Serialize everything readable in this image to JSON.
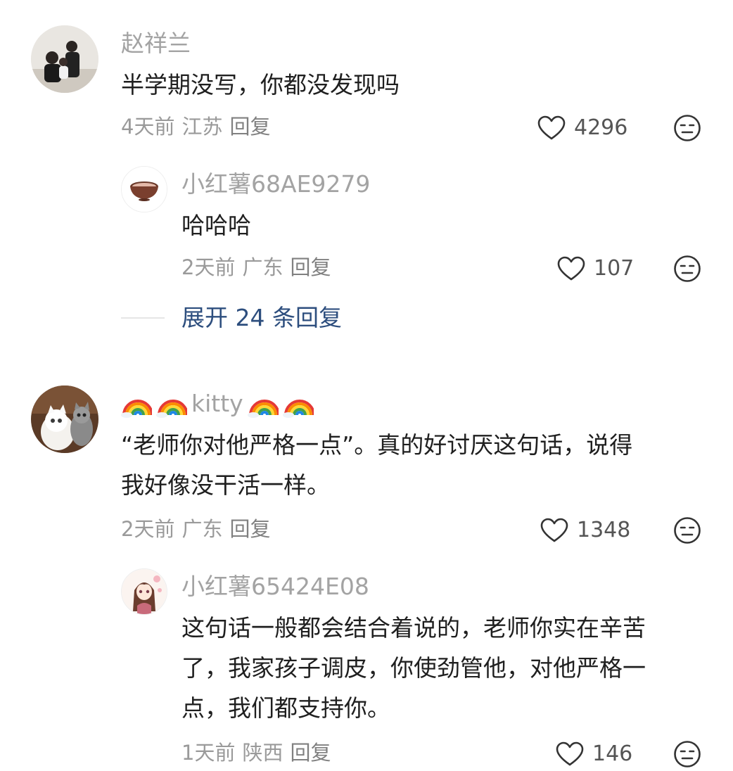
{
  "comments": [
    {
      "author": "赵祥兰",
      "text": "半学期没写，你都没发现吗",
      "time": "4天前",
      "location": "江苏",
      "reply_label": "回复",
      "likes": "4296",
      "replies": [
        {
          "author": "小红薯68AE9279",
          "text": "哈哈哈",
          "time": "2天前",
          "location": "广东",
          "reply_label": "回复",
          "likes": "107"
        }
      ],
      "expand_label": "展开 24 条回复"
    },
    {
      "author": "kitty",
      "author_emoji": "rainbow-emoji",
      "text_line1": "“老师你对他严格一点”。真的好讨厌这句话，说得",
      "text_line2": "我好像没干活一样。",
      "time": "2天前",
      "location": "广东",
      "reply_label": "回复",
      "likes": "1348",
      "replies": [
        {
          "author": "小红薯65424E08",
          "text_line1": "这句话一般都会结合着说的，老师你实在辛苦",
          "text_line2": "了，我家孩子调皮，你使劲管他，对他严格一",
          "text_line3": "点，我们都支持你。",
          "time": "1天前",
          "location": "陕西",
          "reply_label": "回复",
          "likes": "146"
        }
      ]
    }
  ],
  "icons": {
    "like": "heart-outline-icon",
    "dislike": "unamused-face-icon"
  },
  "colors": {
    "author": "#a3a3a3",
    "text": "#1f1f1f",
    "meta": "#9a9a9a",
    "expand": "#2d4e7e",
    "icon_stroke": "#333333"
  }
}
